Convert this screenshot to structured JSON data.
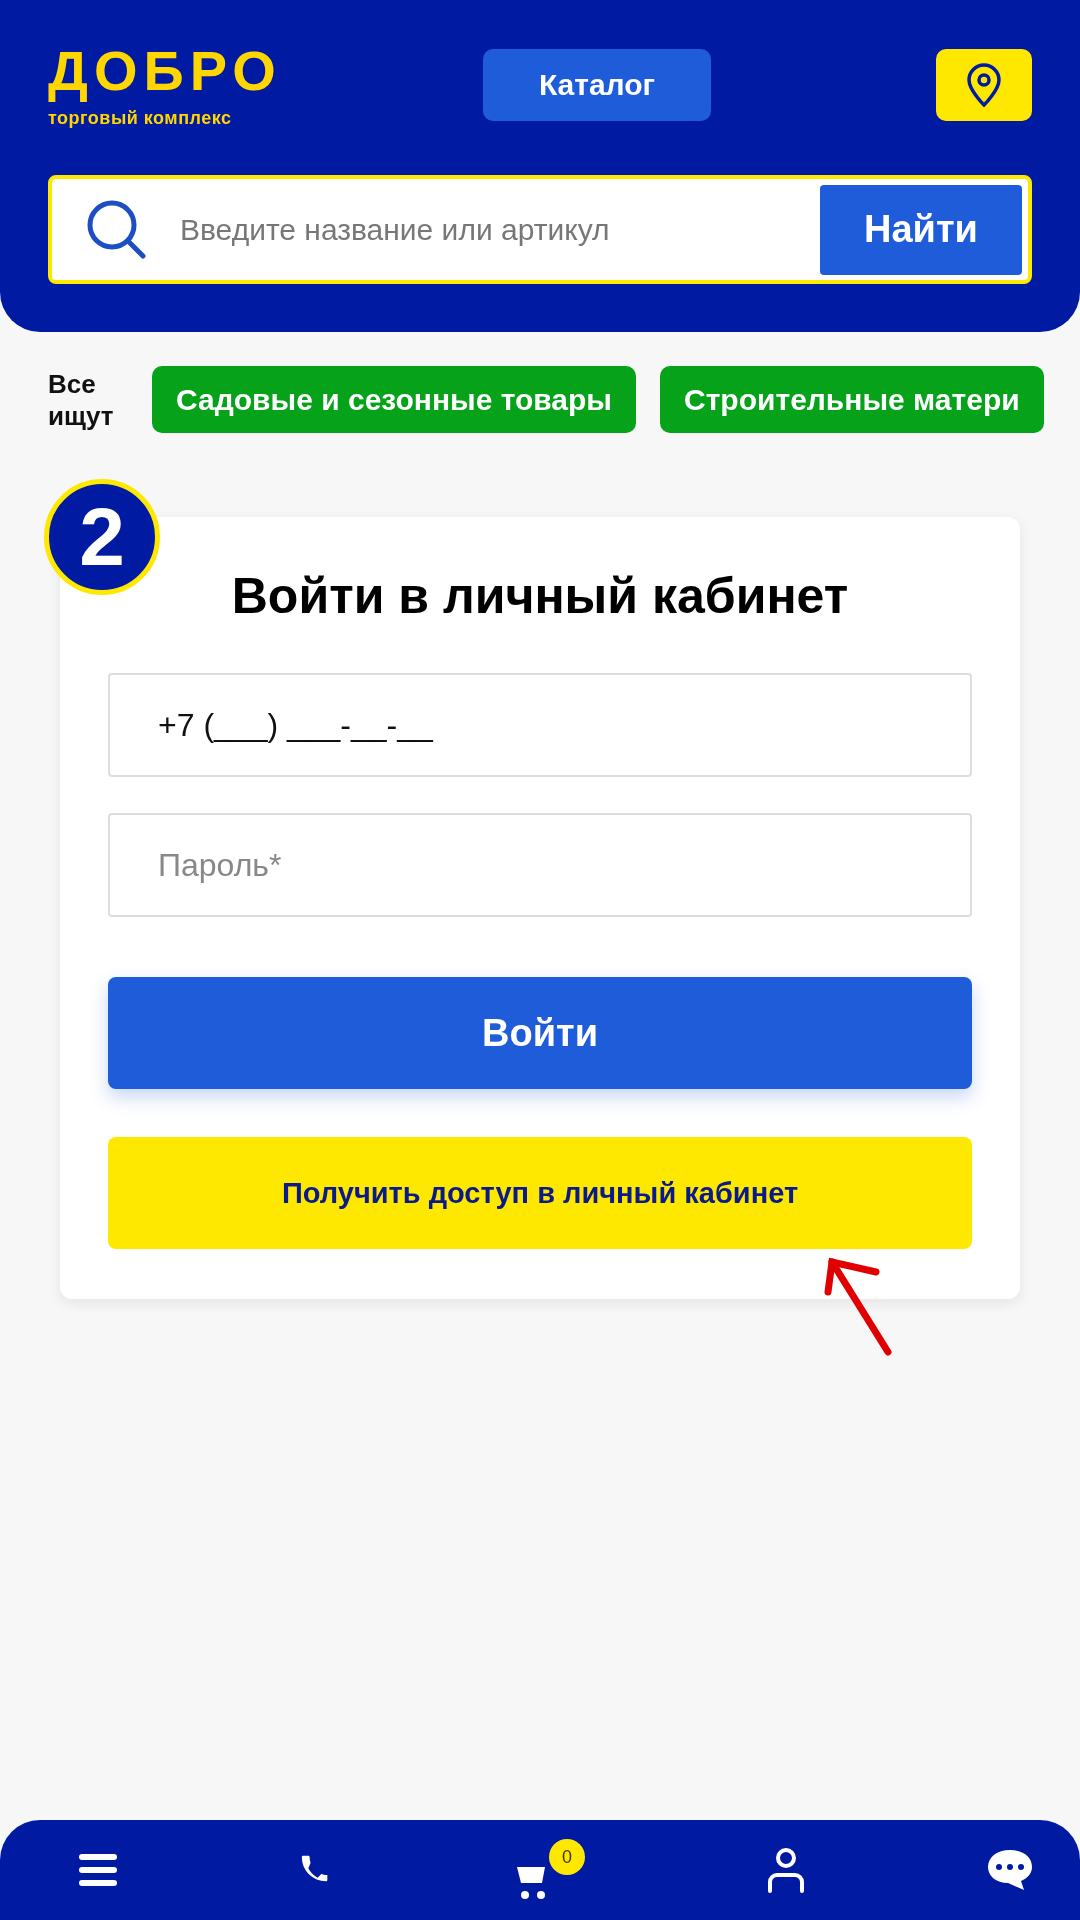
{
  "header": {
    "logo": {
      "title": "ДОБРО",
      "subtitle": "торговый комплекс"
    },
    "catalog_button": "Каталог",
    "search": {
      "placeholder": "Введите название или артикул",
      "button": "Найти"
    }
  },
  "popular": {
    "label": "Все ищут",
    "chips": [
      "Садовые и сезонные товары",
      "Строительные матери"
    ]
  },
  "step_badge": "2",
  "login": {
    "title": "Войти в личный кабинет",
    "phone": {
      "value": "+7 (___) ___-__-__"
    },
    "password": {
      "placeholder": "Пароль*"
    },
    "submit": "Войти",
    "access_button": "Получить доступ в личный кабинет"
  },
  "bottom_nav": {
    "cart_count": "0"
  }
}
